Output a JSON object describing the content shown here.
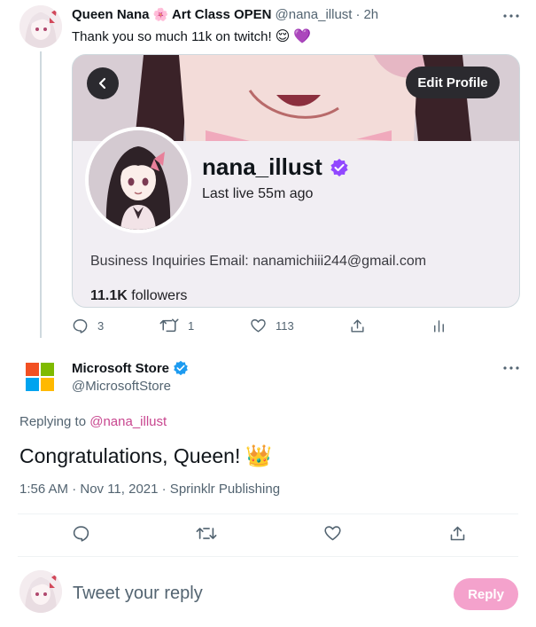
{
  "parent_tweet": {
    "author_name": "Queen Nana",
    "author_name_suffix": "Art Class OPEN",
    "handle": "@nana_illust",
    "separator": "·",
    "time": "2h",
    "text": "Thank you so much 11k on twitch!",
    "card": {
      "edit_label": "Edit Profile",
      "username": "nana_illust",
      "last_live": "Last live 55m ago",
      "email_line": "Business Inquiries Email: nanamichiii244@gmail.com",
      "followers_count": "11.1K",
      "followers_label": "followers"
    },
    "actions": {
      "replies": "3",
      "retweets": "1",
      "likes": "113"
    }
  },
  "focal_tweet": {
    "author_name": "Microsoft Store",
    "handle": "@MicrosoftStore",
    "replying_prefix": "Replying to",
    "replying_to": "@nana_illust",
    "text": "Congratulations, Queen!",
    "timestamp": "1:56 AM · Nov 11, 2021 · Sprinklr Publishing"
  },
  "composer": {
    "placeholder": "Tweet your reply",
    "reply_label": "Reply"
  },
  "colors": {
    "accent_pink": "#f4a2cc",
    "verified_twitter": "#1d9bf0",
    "verified_twitch": "#9147ff",
    "ms_red": "#f25022",
    "ms_green": "#7fba00",
    "ms_blue": "#00a4ef",
    "ms_yellow": "#ffb900"
  }
}
